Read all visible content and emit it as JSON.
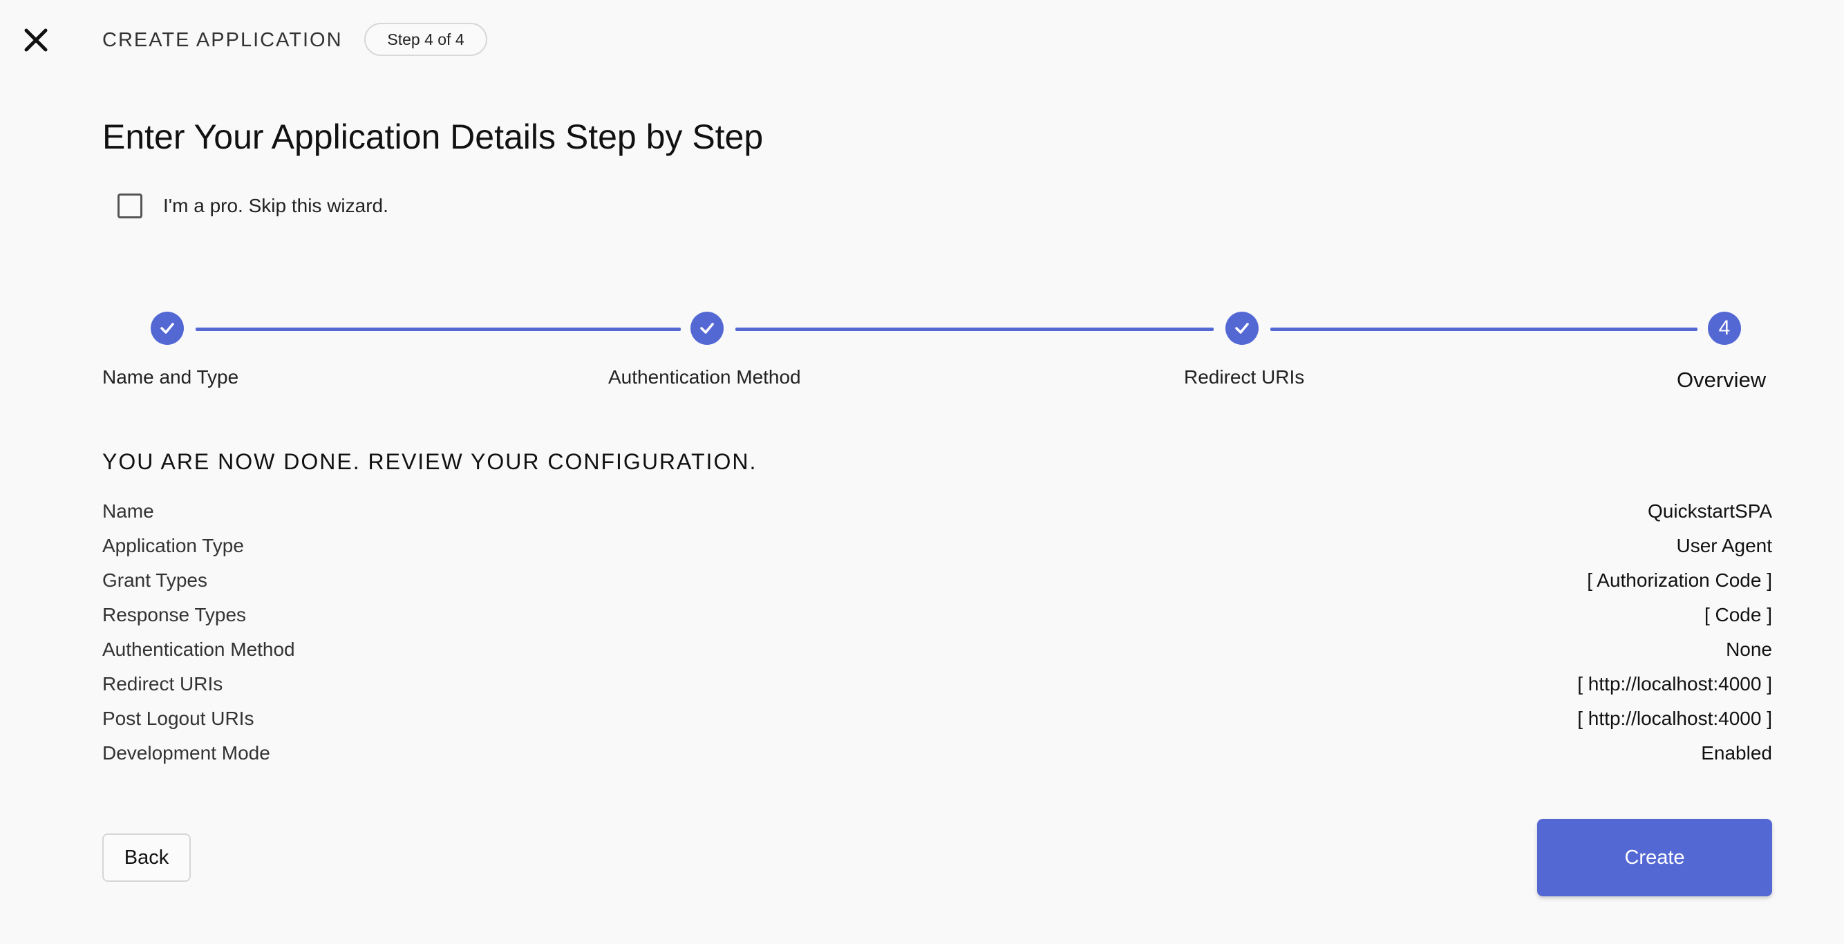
{
  "header": {
    "title": "CREATE APPLICATION",
    "step_badge": "Step 4 of 4"
  },
  "main": {
    "title": "Enter Your Application Details Step by Step",
    "skip_label": "I'm a pro. Skip this wizard.",
    "skip_checked": false
  },
  "stepper": {
    "accent_color": "#5468d4",
    "steps": [
      {
        "label": "Name and Type",
        "state": "completed"
      },
      {
        "label": "Authentication Method",
        "state": "completed"
      },
      {
        "label": "Redirect URIs",
        "state": "completed"
      },
      {
        "label": "Overview",
        "state": "active",
        "number": "4"
      }
    ]
  },
  "review": {
    "heading": "YOU ARE NOW DONE. REVIEW YOUR CONFIGURATION.",
    "rows": [
      {
        "key": "Name",
        "value": "QuickstartSPA"
      },
      {
        "key": "Application Type",
        "value": "User Agent"
      },
      {
        "key": "Grant Types",
        "value": "[ Authorization Code ]"
      },
      {
        "key": "Response Types",
        "value": "[ Code ]"
      },
      {
        "key": "Authentication Method",
        "value": "None"
      },
      {
        "key": "Redirect URIs",
        "value": "[ http://localhost:4000 ]"
      },
      {
        "key": "Post Logout URIs",
        "value": "[ http://localhost:4000 ]"
      },
      {
        "key": "Development Mode",
        "value": "Enabled"
      }
    ]
  },
  "actions": {
    "back_label": "Back",
    "create_label": "Create"
  },
  "icons": {
    "close": "close-icon",
    "check": "check-icon"
  }
}
